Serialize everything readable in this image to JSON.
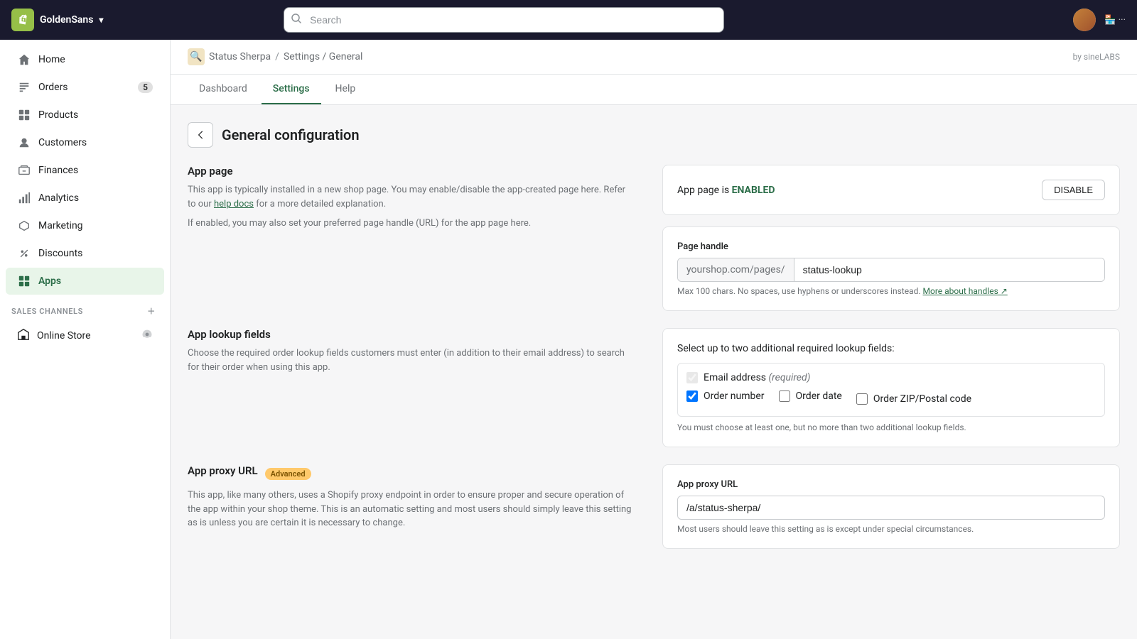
{
  "topbar": {
    "store_name": "GoldenSans",
    "search_placeholder": "Search",
    "by_label": "by sineLABS"
  },
  "sidebar": {
    "nav_items": [
      {
        "id": "home",
        "label": "Home",
        "icon": "home"
      },
      {
        "id": "orders",
        "label": "Orders",
        "icon": "orders",
        "badge": "5"
      },
      {
        "id": "products",
        "label": "Products",
        "icon": "products"
      },
      {
        "id": "customers",
        "label": "Customers",
        "icon": "customers"
      },
      {
        "id": "finances",
        "label": "Finances",
        "icon": "finances"
      },
      {
        "id": "analytics",
        "label": "Analytics",
        "icon": "analytics"
      },
      {
        "id": "marketing",
        "label": "Marketing",
        "icon": "marketing"
      },
      {
        "id": "discounts",
        "label": "Discounts",
        "icon": "discounts"
      },
      {
        "id": "apps",
        "label": "Apps",
        "icon": "apps",
        "active": true
      }
    ],
    "sales_channels_label": "SALES CHANNELS",
    "sales_channels": [
      {
        "id": "online-store",
        "label": "Online Store"
      }
    ]
  },
  "breadcrumb": {
    "app_name": "Status Sherpa",
    "separator": "/",
    "path": "Settings / General"
  },
  "tabs": [
    {
      "id": "dashboard",
      "label": "Dashboard",
      "active": false
    },
    {
      "id": "settings",
      "label": "Settings",
      "active": true
    },
    {
      "id": "help",
      "label": "Help",
      "active": false
    }
  ],
  "page": {
    "title": "General configuration",
    "sections": {
      "app_page": {
        "title": "App page",
        "description_1": "This app is typically installed in a new shop page. You may enable/disable the app-created page here. Refer to our",
        "help_docs_link": "help docs",
        "description_2": "for a more detailed explanation.",
        "description_3": "If enabled, you may also set your preferred page handle (URL) for the app page here.",
        "status_prefix": "App page is",
        "status_value": "ENABLED",
        "disable_btn": "DISABLE"
      },
      "page_handle": {
        "label": "Page handle",
        "prefix": "yourshop.com/pages/",
        "value": "status-lookup",
        "hint": "Max 100 chars. No spaces, use hyphens or underscores instead.",
        "link_text": "More about handles",
        "link_icon": "↗"
      },
      "app_lookup": {
        "title": "App lookup fields",
        "description": "Choose the required order lookup fields customers must enter (in addition to their email address) to search for their order when using this app.",
        "select_label": "Select up to two additional required lookup fields:",
        "fields": [
          {
            "id": "email",
            "label": "Email address",
            "required_label": "(required)",
            "checked": true,
            "disabled": true
          },
          {
            "id": "order_number",
            "label": "Order number",
            "checked": true,
            "disabled": false
          },
          {
            "id": "order_date",
            "label": "Order date",
            "checked": false,
            "disabled": false
          },
          {
            "id": "order_zip",
            "label": "Order ZIP/Postal code",
            "checked": false,
            "disabled": false
          }
        ],
        "note": "You must choose at least one, but no more than two additional lookup fields."
      },
      "app_proxy": {
        "title": "App proxy URL",
        "advanced_label": "Advanced",
        "description": "This app, like many others, uses a Shopify proxy endpoint in order to ensure proper and secure operation of the app within your shop theme. This is an automatic setting and most users should simply leave this setting as is unless you are certain it is necessary to change.",
        "label": "App proxy URL",
        "value": "/a/status-sherpa/",
        "hint": "Most users should leave this setting as is except under special circumstances."
      }
    }
  }
}
